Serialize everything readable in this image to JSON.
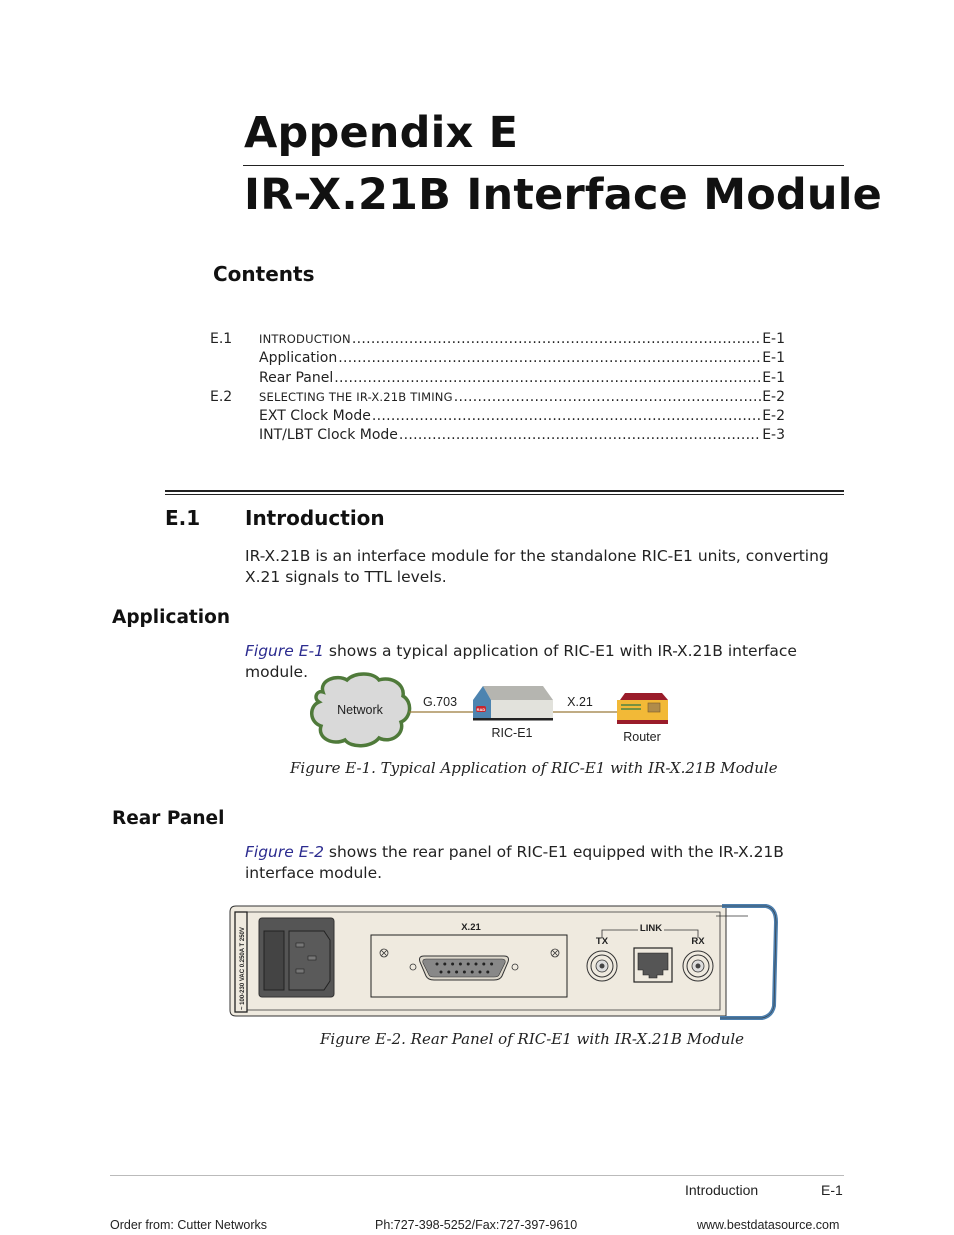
{
  "header": {
    "appendix_title": "Appendix E",
    "module_title": "IR-X.21B Interface Module"
  },
  "contents": {
    "heading": "Contents",
    "entries": [
      {
        "number": "E.1",
        "label": "Introduction",
        "smallcaps": true,
        "page": "E-1",
        "level": 1
      },
      {
        "number": "",
        "label": "Application",
        "smallcaps": false,
        "page": "E-1",
        "level": 2
      },
      {
        "number": "",
        "label": "Rear Panel",
        "smallcaps": false,
        "page": "E-1",
        "level": 2
      },
      {
        "number": "E.2",
        "label": "Selecting the IR-X.21B Timing",
        "smallcaps": true,
        "page": "E-2",
        "level": 1
      },
      {
        "number": "",
        "label": "EXT Clock Mode",
        "smallcaps": false,
        "page": "E-2",
        "level": 2
      },
      {
        "number": "",
        "label": "INT/LBT Clock Mode",
        "smallcaps": false,
        "page": "E-3",
        "level": 2
      }
    ]
  },
  "section": {
    "number": "E.1",
    "title": "Introduction",
    "intro_text": "IR-X.21B is an interface module for the standalone RIC-E1 units, converting X.21 signals to TTL levels."
  },
  "application": {
    "heading": "Application",
    "figure_ref": "Figure E-1",
    "text": " shows a typical application of RIC-E1 with IR-X.21B interface module.",
    "diagram": {
      "network_label": "Network",
      "link1_label": "G.703",
      "device_label": "RIC-E1",
      "device_logo": "RAD",
      "link2_label": "X.21",
      "router_label": "Router"
    },
    "caption": "Figure E-1.  Typical Application of RIC-E1 with IR-X.21B Module"
  },
  "rear_panel": {
    "heading": "Rear Panel",
    "figure_ref": "Figure E-2",
    "text": " shows the rear panel of RIC-E1 equipped with the IR-X.21B interface module.",
    "diagram": {
      "power_label": "~ 100-230 VAC  0.250A T 250V",
      "x21_label": "X.21",
      "link_label": "LINK",
      "tx_label": "TX",
      "rx_label": "RX"
    },
    "caption": "Figure E-2.  Rear Panel of RIC-E1 with IR-X.21B Module"
  },
  "footer": {
    "section_name": "Introduction",
    "page_number": "E-1",
    "order_from": "Order from: Cutter Networks",
    "phone_fax": "Ph:727-398-5252/Fax:727-397-9610",
    "website": "www.bestdatasource.com"
  },
  "colors": {
    "link_text": "#2b2b8f",
    "cloud_outline": "#4f7a3a",
    "cloud_fill": "#d8d8d8",
    "device_blue": "#4d84b0",
    "router_yellow": "#f2b937",
    "router_red": "#9a1c2a",
    "panel_fill": "#efeadf",
    "panel_handle_blue": "#4d7fae"
  }
}
